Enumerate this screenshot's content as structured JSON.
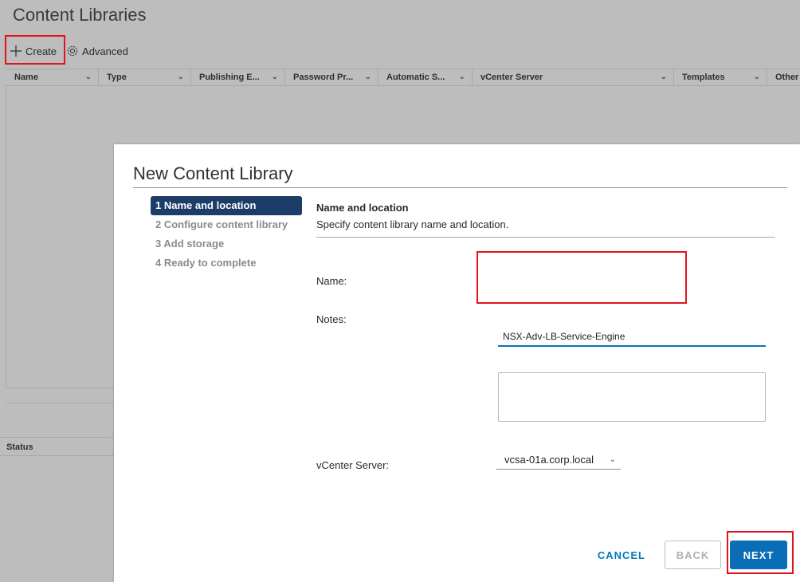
{
  "page": {
    "title": "Content Libraries",
    "toolbar": {
      "create_label": "Create",
      "advanced_label": "Advanced"
    },
    "columns": [
      "Name",
      "Type",
      "Publishing E...",
      "Password Pr...",
      "Automatic S...",
      "vCenter Server",
      "Templates",
      "Other"
    ],
    "status_header": "Status"
  },
  "modal": {
    "title": "New Content Library",
    "steps": [
      {
        "label": "1 Name and location",
        "active": true
      },
      {
        "label": "2 Configure content library",
        "active": false
      },
      {
        "label": "3 Add storage",
        "active": false
      },
      {
        "label": "4 Ready to complete",
        "active": false
      }
    ],
    "section_title": "Name and location",
    "section_description": "Specify content library name and location.",
    "name_label": "Name:",
    "name_value": "NSX-Adv-LB-Service-Engine",
    "notes_label": "Notes:",
    "notes_value": "",
    "vcenter_label": "vCenter Server:",
    "vcenter_value": "vcsa-01a.corp.local",
    "buttons": {
      "cancel": "CANCEL",
      "back": "BACK",
      "next": "NEXT"
    }
  },
  "colors": {
    "highlight": "#e0141e",
    "primary": "#0a6db5",
    "active_step": "#1b3d68"
  },
  "icons": [
    "plus-icon",
    "gear-icon",
    "chevron-down-icon"
  ]
}
